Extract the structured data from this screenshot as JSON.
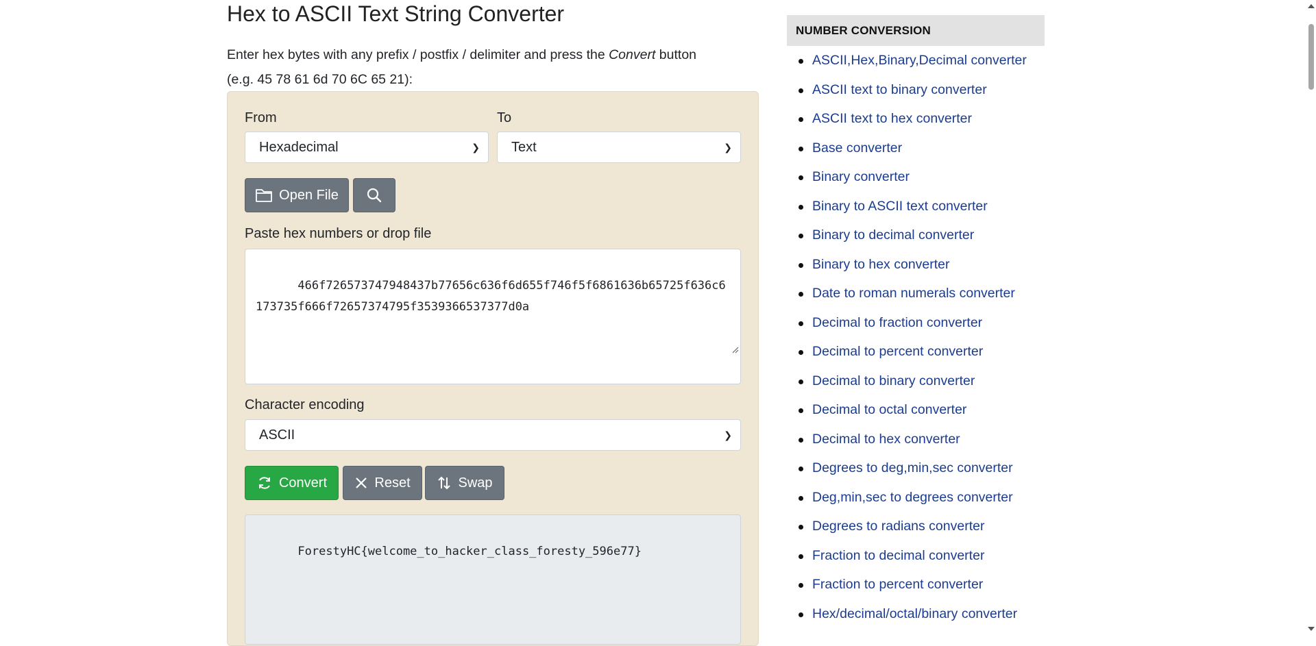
{
  "page": {
    "title": "Hex to ASCII Text String Converter",
    "intro_before": "Enter hex bytes with any prefix / postfix / delimiter and press the ",
    "intro_emphasis": "Convert",
    "intro_after": " button",
    "intro_example": "(e.g. 45 78 61 6d 70 6C 65 21):"
  },
  "form": {
    "from_label": "From",
    "from_value": "Hexadecimal",
    "to_label": "To",
    "to_value": "Text",
    "open_file_label": "Open File",
    "input_label": "Paste hex numbers or drop file",
    "input_value": "466f726573747948437b77656c636f6d655f746f5f6861636b65725f636c6173735f666f72657374795f3539366537377d0a",
    "encoding_label": "Character encoding",
    "encoding_value": "ASCII",
    "convert_label": "Convert",
    "reset_label": "Reset",
    "swap_label": "Swap",
    "output_value": "ForestyHC{welcome_to_hacker_class_foresty_596e77}"
  },
  "sidebar": {
    "heading": "NUMBER CONVERSION",
    "links": [
      "ASCII,Hex,Binary,Decimal converter",
      "ASCII text to binary converter",
      "ASCII text to hex converter",
      "Base converter",
      "Binary converter",
      "Binary to ASCII text converter",
      "Binary to decimal converter",
      "Binary to hex converter",
      "Date to roman numerals converter",
      "Decimal to fraction converter",
      "Decimal to percent converter",
      "Decimal to binary converter",
      "Decimal to octal converter",
      "Decimal to hex converter",
      "Degrees to deg,min,sec converter",
      "Deg,min,sec to degrees converter",
      "Degrees to radians converter",
      "Fraction to decimal converter",
      "Fraction to percent converter",
      "Hex/decimal/octal/binary converter"
    ]
  },
  "colors": {
    "panel_bg": "#efe7d4",
    "button_gray": "#6c757d",
    "button_green": "#28a745",
    "link": "#1b3c8f"
  }
}
